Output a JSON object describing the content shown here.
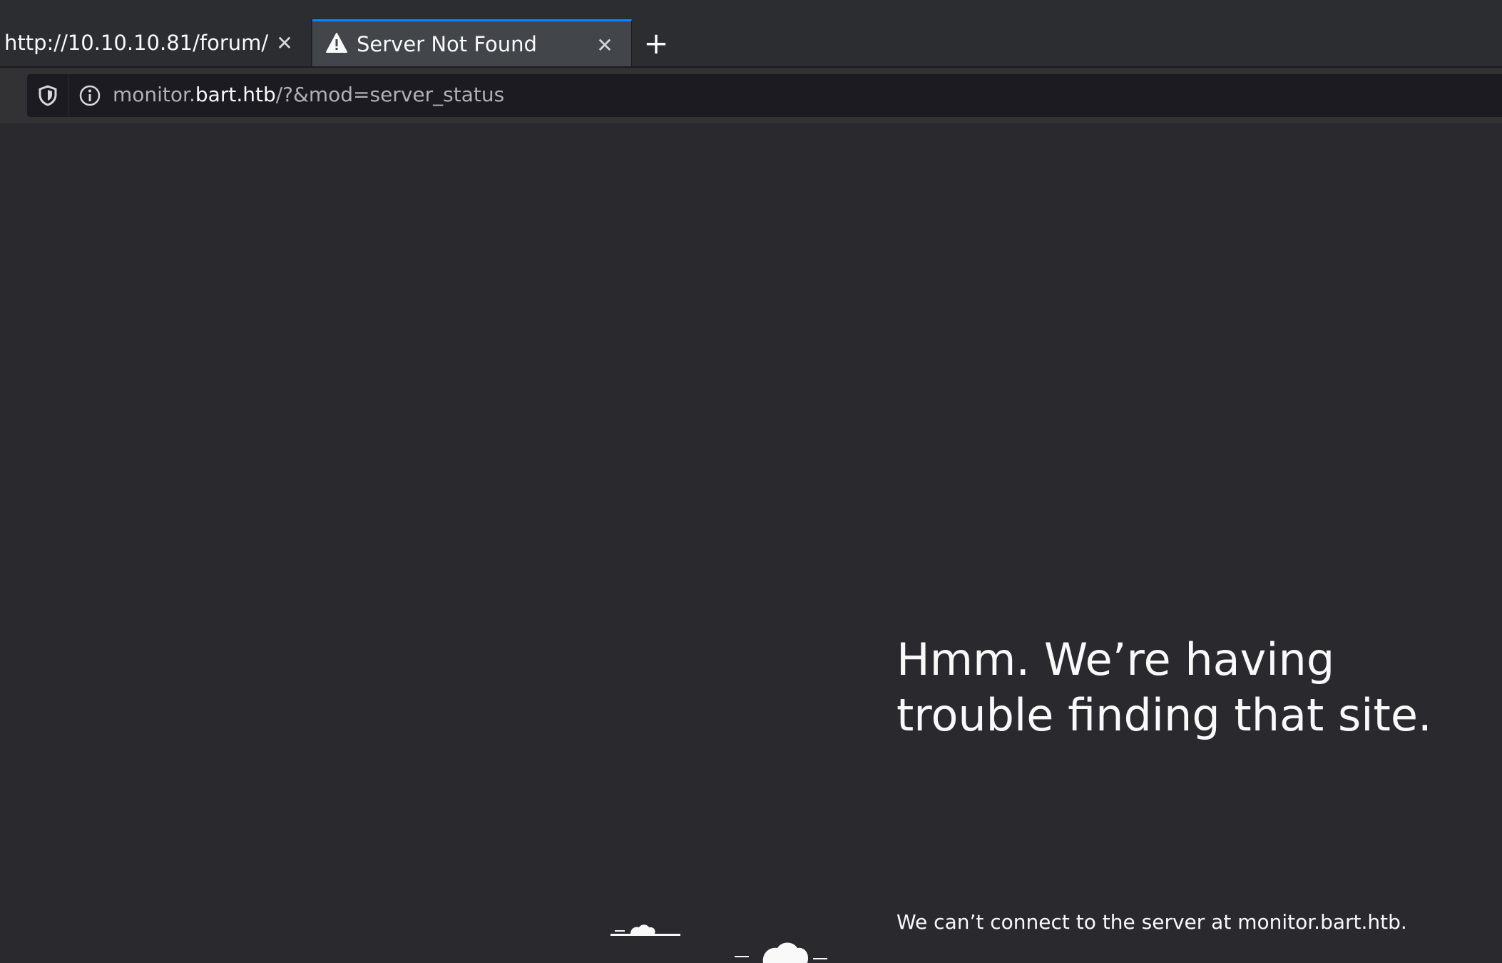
{
  "tabs": [
    {
      "title": "http://10.10.10.81/forum/",
      "active": false,
      "icon": "none"
    },
    {
      "title": "Server Not Found",
      "active": true,
      "icon": "warning-icon"
    }
  ],
  "toolbar": {
    "close_glyph": "✕",
    "new_tab_glyph": "+"
  },
  "urlbar": {
    "subdomain": "monitor.",
    "host": "bart.htb",
    "path": "/?&mod=server_status",
    "icons": [
      "shield-icon",
      "info-icon"
    ]
  },
  "error_page": {
    "title": "Hmm. We’re having trouble finding that site.",
    "description": "We can’t connect to the server at monitor.bart.htb."
  },
  "colors": {
    "background": "#2a2a2e",
    "tabbar": "#2b2d30",
    "active_tab": "#42454a",
    "accent": "#0a84ff",
    "urlbar": "#1c1b22",
    "text": "#f9f9fa",
    "muted_text": "#b1b1b3"
  }
}
